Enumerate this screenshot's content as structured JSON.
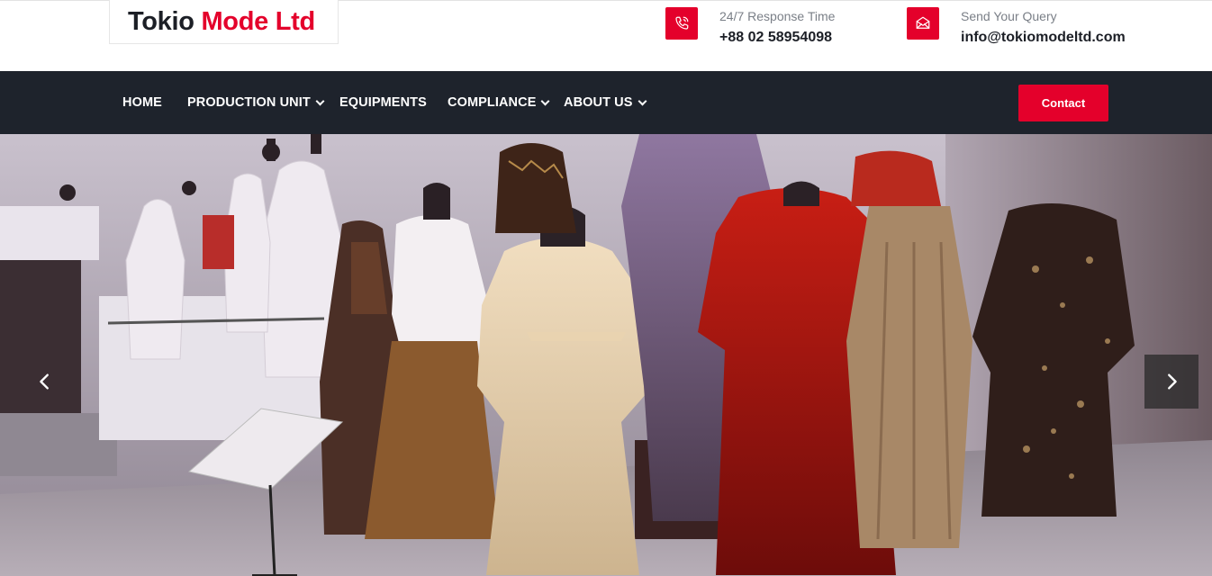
{
  "brand": {
    "name_part1": "Tokio ",
    "name_part2": "Mode Ltd"
  },
  "contact_info": {
    "phone_label": "24/7 Response Time",
    "phone_value": "+88 02 58954098",
    "email_label": "Send Your Query",
    "email_value": "info@tokiomodeltd.com"
  },
  "nav": {
    "items": [
      {
        "label": "HOME"
      },
      {
        "label": "PRODUCTION UNIT"
      },
      {
        "label": "EQUIPMENTS"
      },
      {
        "label": "COMPLIANCE"
      },
      {
        "label": "ABOUT US"
      }
    ],
    "contact_button": "Contact"
  },
  "colors": {
    "accent": "#e4002b",
    "navbar": "#1e232c",
    "text_dark": "#1c1f26"
  },
  "icons": {
    "phone": "phone-icon",
    "mail": "mail-icon",
    "dropdown": "chevron-down-icon",
    "prev": "chevron-left-icon",
    "next": "chevron-right-icon"
  }
}
